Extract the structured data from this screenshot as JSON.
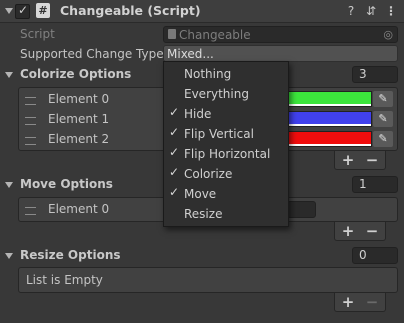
{
  "header": {
    "title": "Changeable (Script)",
    "help_icon": "help-icon",
    "preset_icon": "presets-icon",
    "menu_icon": "kebab-menu-icon"
  },
  "script_field": {
    "label": "Script",
    "value": "Changeable"
  },
  "supported_change_types": {
    "label": "Supported Change Types",
    "value": "Mixed..."
  },
  "colorize_options": {
    "title": "Colorize Options",
    "count": "3",
    "elements": [
      {
        "label": "Element 0",
        "color": "#3ce63c"
      },
      {
        "label": "Element 1",
        "color": "#4141ee"
      },
      {
        "label": "Element 2",
        "color": "#f20d0d"
      }
    ]
  },
  "move_options": {
    "title": "Move Options",
    "count": "1",
    "elements": [
      {
        "label": "Element 0"
      }
    ]
  },
  "resize_options": {
    "title": "Resize Options",
    "count": "0",
    "empty_text": "List is Empty"
  },
  "footer": {
    "add": "+",
    "remove": "−"
  },
  "dropdown_menu": {
    "items": [
      {
        "label": "Nothing",
        "checked": false
      },
      {
        "label": "Everything",
        "checked": false
      },
      {
        "label": "Hide",
        "checked": true
      },
      {
        "label": "Flip Vertical",
        "checked": true
      },
      {
        "label": "Flip Horizontal",
        "checked": true
      },
      {
        "label": "Colorize",
        "checked": true
      },
      {
        "label": "Move",
        "checked": true
      },
      {
        "label": "Resize",
        "checked": false
      }
    ]
  }
}
